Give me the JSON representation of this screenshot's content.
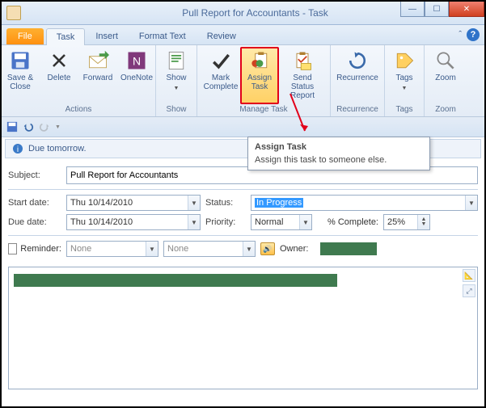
{
  "window": {
    "title": "Pull Report for Accountants  -  Task"
  },
  "tabs": {
    "file": "File",
    "task": "Task",
    "insert": "Insert",
    "format": "Format Text",
    "review": "Review"
  },
  "ribbon": {
    "save_close": "Save & Close",
    "delete": "Delete",
    "forward": "Forward",
    "onenote": "OneNote",
    "show": "Show",
    "mark_complete": "Mark Complete",
    "assign_task": "Assign Task",
    "send_status": "Send Status Report",
    "recurrence": "Recurrence",
    "tags": "Tags",
    "zoom": "Zoom",
    "grp_actions": "Actions",
    "grp_show": "Show",
    "grp_manage": "Manage Task",
    "grp_recurrence": "Recurrence",
    "grp_tags": "Tags",
    "grp_zoom": "Zoom"
  },
  "info": {
    "due": "Due tomorrow."
  },
  "form": {
    "subject_lbl": "Subject:",
    "subject_val": "Pull Report for Accountants",
    "start_lbl": "Start date:",
    "start_val": "Thu 10/14/2010",
    "due_lbl": "Due date:",
    "due_val": "Thu 10/14/2010",
    "status_lbl": "Status:",
    "status_val": "In Progress",
    "priority_lbl": "Priority:",
    "priority_val": "Normal",
    "pct_lbl": "% Complete:",
    "pct_val": "25%",
    "reminder_lbl": "Reminder:",
    "reminder_date": "None",
    "reminder_time": "None",
    "owner_lbl": "Owner:"
  },
  "tooltip": {
    "title": "Assign Task",
    "body": "Assign this task to someone else."
  }
}
